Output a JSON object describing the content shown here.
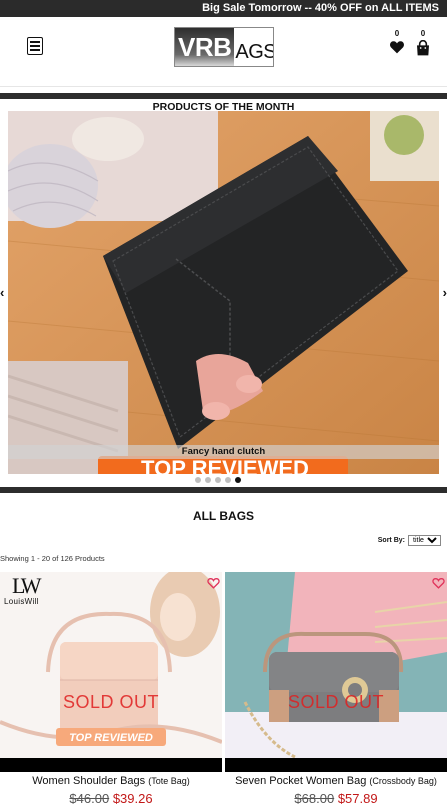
{
  "promo": {
    "text": "Big Sale Tomorrow -- 40% OFF on ALL ITEMS"
  },
  "header": {
    "logo_dark": "VRB",
    "logo_light": "AGS",
    "wishlist_count": "0",
    "cart_count": "0"
  },
  "carousel": {
    "title": "PRODUCTS OF THE MONTH",
    "caption": "Fancy hand clutch",
    "banner_text": "TOP REVIEWED",
    "prev": "‹",
    "next": "›",
    "slide_count": 5,
    "active_slide": 5
  },
  "catalog": {
    "title": "ALL BAGS",
    "showing": "Showing 1 - 20 of 126 Products",
    "sort_label": "Sort By:",
    "sort_value": "title"
  },
  "products": [
    {
      "brand": "LouisWill",
      "brand_mark": "LW",
      "badge": "TOP REVIEWED",
      "status": "SOLD OUT",
      "name": "Women Shoulder Bags",
      "category": "(Tote Bag)",
      "old_price": "$46.00",
      "new_price": "$39.26"
    },
    {
      "status": "SOLD OUT",
      "name": "Seven Pocket Women Bag",
      "category": "(Crossbody Bag)",
      "old_price": "$68.00",
      "new_price": "$57.89"
    }
  ],
  "colors": {
    "dark_band": "#2d2d2d",
    "sold_out": "#e02020",
    "sale_price": "#c21818",
    "banner_orange": "#f26b1d"
  },
  "icons": [
    "hamburger-icon",
    "heart-icon",
    "shopping-bag-icon",
    "chevron-left-icon",
    "chevron-right-icon"
  ]
}
